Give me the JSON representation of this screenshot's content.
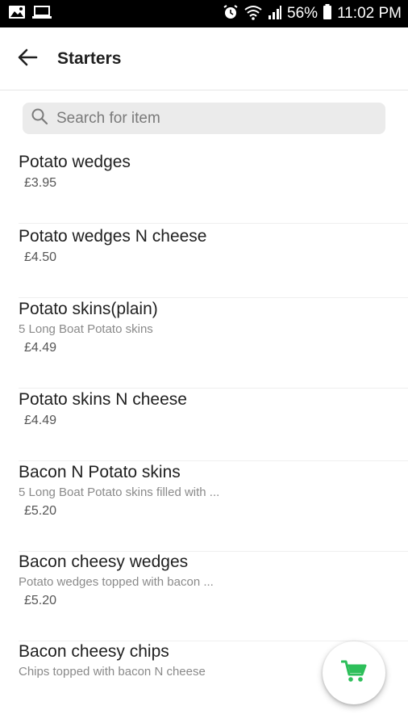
{
  "status_bar": {
    "battery_percent": "56%",
    "time": "11:02 PM",
    "icons": [
      "image-icon",
      "laptop-icon",
      "alarm-icon",
      "wifi-icon",
      "signal-icon",
      "battery-icon"
    ]
  },
  "header": {
    "back_icon": "arrow-back-icon",
    "title": "Starters"
  },
  "search": {
    "icon": "search-icon",
    "placeholder": "Search for item",
    "value": ""
  },
  "items": [
    {
      "name": "Potato wedges",
      "description": "",
      "price": "£3.95"
    },
    {
      "name": "Potato wedges N cheese",
      "description": "",
      "price": "£4.50"
    },
    {
      "name": "Potato skins(plain)",
      "description": "5 Long Boat Potato skins",
      "price": "£4.49"
    },
    {
      "name": "Potato skins N cheese",
      "description": "",
      "price": "£4.49"
    },
    {
      "name": "Bacon N Potato skins",
      "description": "5 Long Boat Potato skins filled with ...",
      "price": "£5.20"
    },
    {
      "name": "Bacon cheesy wedges",
      "description": "Potato wedges topped with bacon ...",
      "price": "£5.20"
    },
    {
      "name": "Bacon cheesy chips",
      "description": "Chips topped with bacon N cheese",
      "price": ""
    }
  ],
  "cart_button": {
    "icon": "cart-icon"
  },
  "colors": {
    "accent_green": "#2dbf5a",
    "status_bar_bg": "#000000",
    "search_bg": "#ebebeb"
  }
}
